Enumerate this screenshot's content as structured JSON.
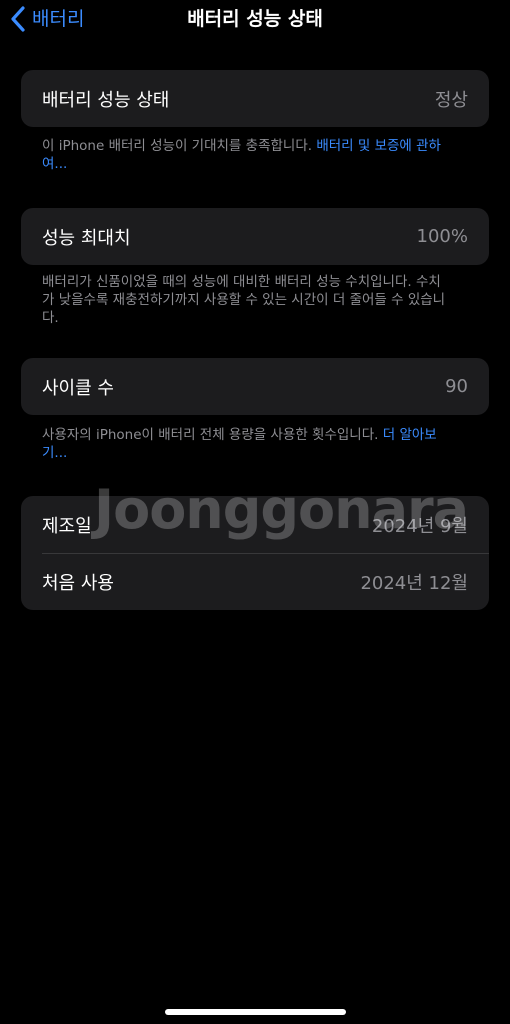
{
  "nav": {
    "back_label": "배터리",
    "title": "배터리 성능 상태"
  },
  "health": {
    "label": "배터리 성능 상태",
    "value": "정상",
    "footnote_text": "이 iPhone 배터리 성능이 기대치를 충족합니다. ",
    "footnote_link": "배터리 및 보증에 관하여..."
  },
  "max_capacity": {
    "label": "성능 최대치",
    "value": "100%",
    "footnote_text": "배터리가 신품이었을 때의 성능에 대비한 배터리 성능 수치입니다. 수치가 낮을수록 재충전하기까지 사용할 수 있는 시간이 더 줄어들 수 있습니다."
  },
  "cycle_count": {
    "label": "사이클 수",
    "value": "90",
    "footnote_text": "사용자의 iPhone이 배터리 전체 용량을 사용한 횟수입니다. ",
    "footnote_link": "더 알아보기..."
  },
  "dates": {
    "manufacture_label": "제조일",
    "manufacture_value": "2024년 9월",
    "first_use_label": "처음 사용",
    "first_use_value": "2024년 12월"
  },
  "watermark": "Joonggonara",
  "colors": {
    "accent": "#3b8cff",
    "card_bg": "#1c1c1e",
    "secondary_text": "#8e8e93"
  }
}
